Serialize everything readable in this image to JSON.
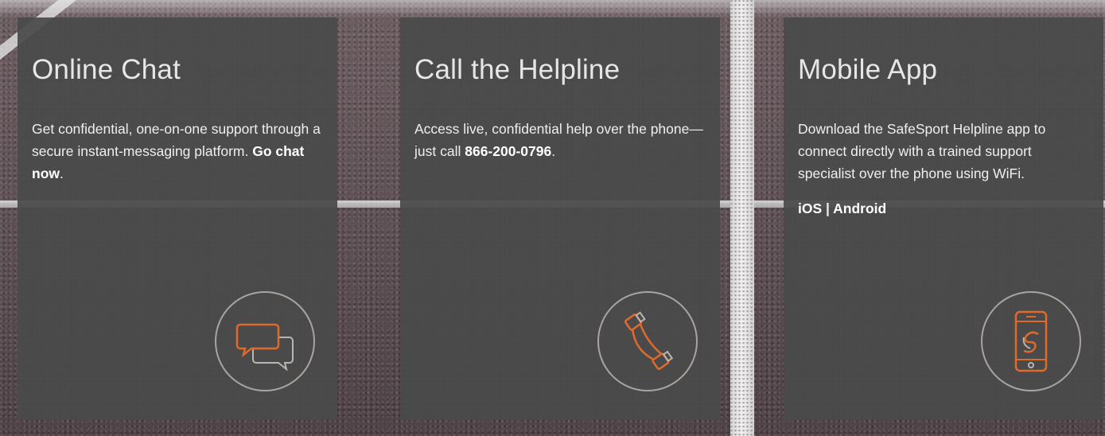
{
  "cards": [
    {
      "title": "Online Chat",
      "body_text": "Get confidential, one-on-one support through a secure instant-messaging platform.",
      "link_label": "Go chat now",
      "body_end": ".",
      "icon": "chat-bubbles-icon"
    },
    {
      "title": "Call the Helpline",
      "body_text": "Access live, confidential help over the phone—just call",
      "phone": "866-200-0796",
      "body_end": ".",
      "icon": "phone-handset-icon"
    },
    {
      "title": "Mobile App",
      "body_text": "Download the SafeSport Helpline app to connect directly with a trained support specialist over the phone using WiFi.",
      "ios_label": "iOS",
      "separator": "|",
      "android_label": "Android",
      "icon": "mobile-phone-icon"
    }
  ],
  "colors": {
    "card_background": "#4a4a4a",
    "accent_icon": "#e06a2c",
    "circle_border": "#c8c3be"
  }
}
